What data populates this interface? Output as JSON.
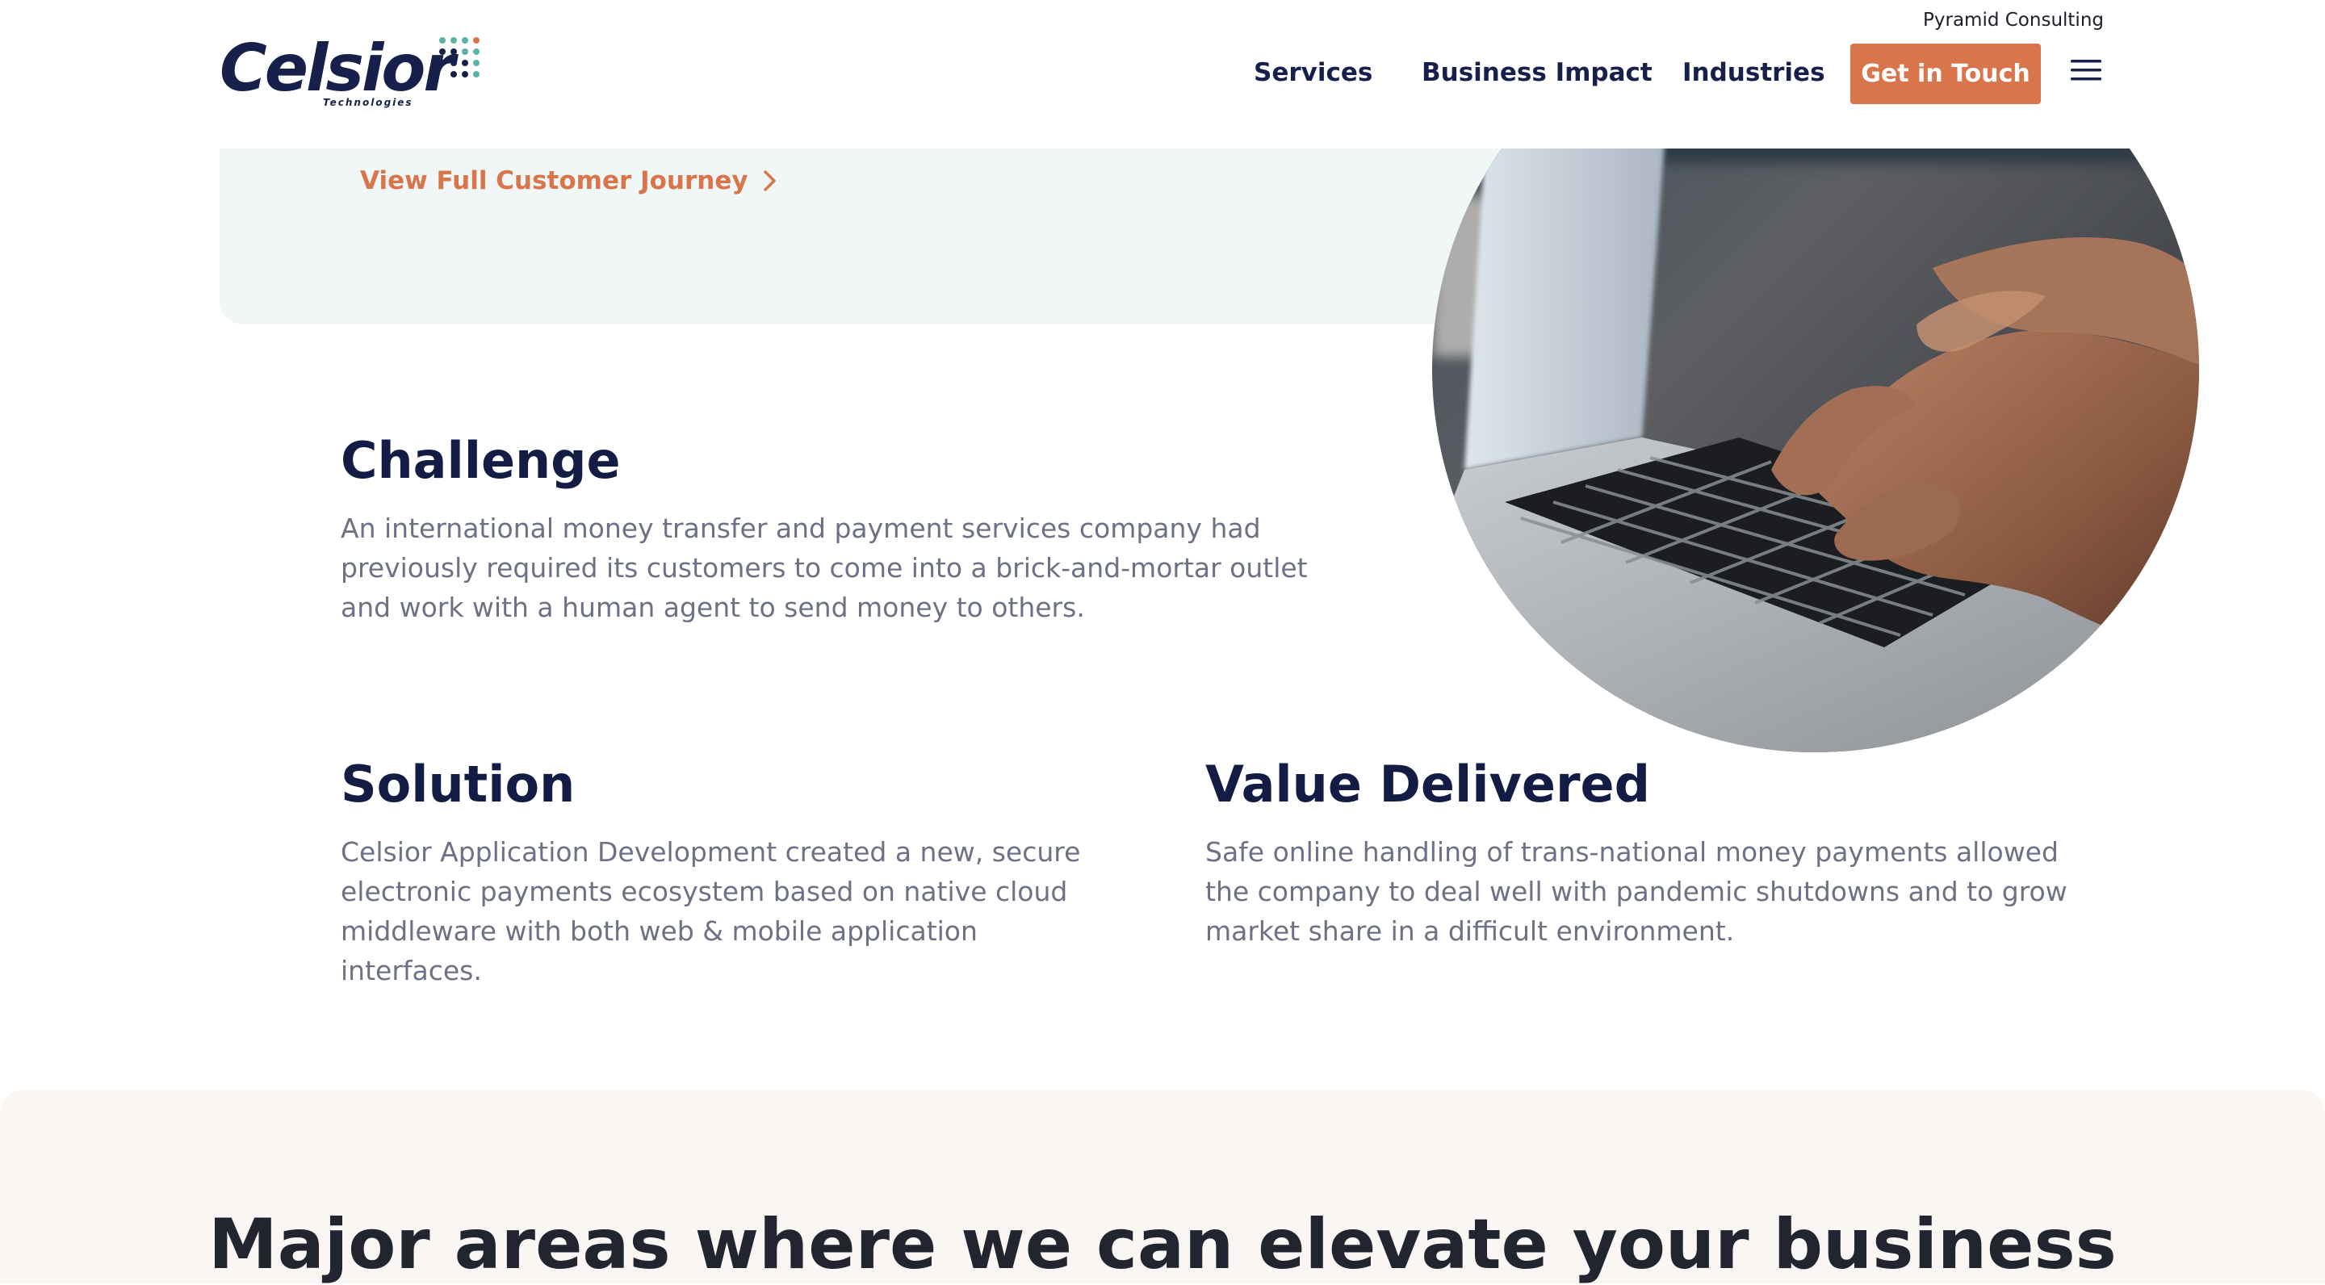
{
  "header": {
    "top_link": "Pyramid Consulting",
    "logo": {
      "wordmark": "Celsior",
      "subtitle": "Technologies",
      "dot_colors": [
        "#5bb3a6",
        "#17204a",
        "#d8754b"
      ]
    },
    "nav": {
      "services": "Services",
      "business_impact": "Business Impact",
      "industries": "Industries"
    },
    "cta_label": "Get in Touch",
    "menu_icon": "hamburger-menu-icon"
  },
  "journey": {
    "link_label": "View Full Customer Journey",
    "link_icon": "chevron-right-icon"
  },
  "photo": {
    "description_icon": "laptop-typing-photo"
  },
  "challenge": {
    "heading": "Challenge",
    "text": "An international money transfer and payment services company had previously required its customers to come into a brick-and-mortar outlet and work with a human agent to send money to others."
  },
  "solution": {
    "heading": "Solution",
    "text": "Celsior Application Development created a new, secure electronic payments ecosystem based on native cloud middleware with both web & mobile application interfaces."
  },
  "value": {
    "heading": "Value Delivered",
    "text": "Safe online handling of trans-national money payments allowed the company to deal well with pandemic shutdowns and to grow market share in a difficult environment."
  },
  "bottom": {
    "heading": "Major areas where we can elevate your business"
  },
  "colors": {
    "accent": "#d8754b",
    "navy": "#17204a",
    "panel": "#f1f6f6",
    "bottom_panel": "#faf6f3",
    "body_text": "#6d7185"
  }
}
